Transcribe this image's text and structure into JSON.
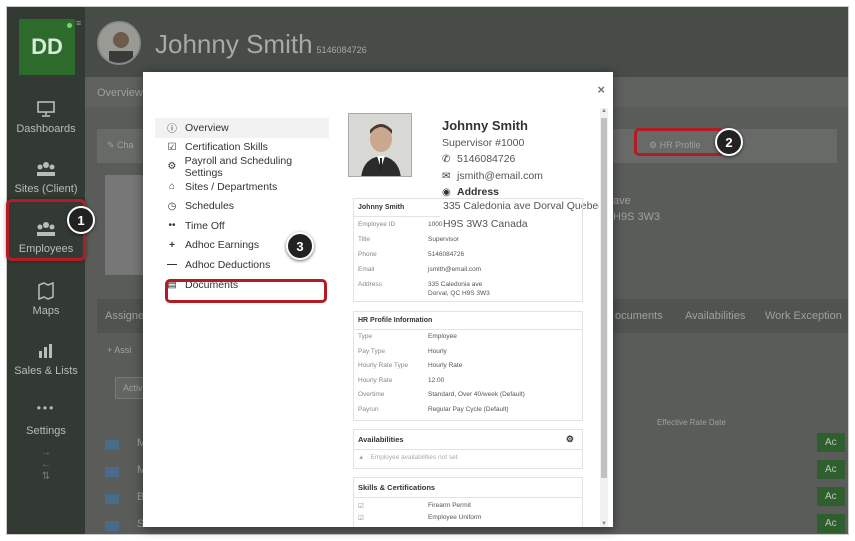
{
  "app": {
    "logo_initials": "DD"
  },
  "sidebar": {
    "items": [
      {
        "label": "Dashboards",
        "icon": "monitor-icon"
      },
      {
        "label": "Sites (Client)",
        "icon": "sites-icon"
      },
      {
        "label": "Employees",
        "icon": "employees-icon"
      },
      {
        "label": "Maps",
        "icon": "map-icon"
      },
      {
        "label": "Sales & Lists",
        "icon": "chart-icon"
      },
      {
        "label": "Settings",
        "icon": "dots-icon"
      }
    ]
  },
  "header": {
    "name": "Johnny Smith",
    "phone": "5146084726"
  },
  "page": {
    "tab_overview": "Overview",
    "change_label": "Cha",
    "hr_profile_tab": "HR Profile",
    "addr_fragment_1": "ave",
    "addr_fragment_2": "H9S 3W3",
    "assigned_label": "Assigne",
    "tabs_right": [
      "ocuments",
      "Availabilities",
      "Work Exception"
    ],
    "assign_button": "Assi",
    "active_filter": "Active",
    "effective_rate_header": "Effective Rate Date",
    "rows": [
      "Mo",
      "Mo",
      "Br",
      "Su"
    ],
    "row_badge": "Ac"
  },
  "modal": {
    "menu": [
      {
        "label": "Overview",
        "icon": "info-icon"
      },
      {
        "label": "Certification Skills",
        "icon": "checkbox-icon"
      },
      {
        "label": "Payroll and Scheduling Settings",
        "icon": "gear-icon"
      },
      {
        "label": "Sites / Departments",
        "icon": "home-icon"
      },
      {
        "label": "Schedules",
        "icon": "clock-icon"
      },
      {
        "label": "Time Off",
        "icon": "ellipsis-icon"
      },
      {
        "label": "Adhoc Earnings",
        "icon": "plus-icon"
      },
      {
        "label": "Adhoc Deductions",
        "icon": "minus-icon"
      },
      {
        "label": "Documents",
        "icon": "document-icon"
      }
    ],
    "profile": {
      "name": "Johnny Smith",
      "role": "Supervisor #1000",
      "phone": "5146084726",
      "email": "jsmith@email.com",
      "address_label": "Address",
      "address_line1": "335 Caledonia ave Dorval Quebec",
      "address_line2": "H9S 3W3 Canada"
    },
    "summary_card": {
      "title": "Johnny Smith",
      "rows": [
        {
          "k": "Employee ID",
          "v": "1000"
        },
        {
          "k": "Title",
          "v": "Supervisor"
        },
        {
          "k": "Phone",
          "v": "5146084726"
        },
        {
          "k": "Email",
          "v": "jsmith@email.com"
        },
        {
          "k": "Address",
          "v": "335 Caledonia ave"
        },
        {
          "k": "",
          "v": "Dorval, QC H9S 3W3"
        }
      ]
    },
    "hr_card": {
      "title": "HR Profile Information",
      "rows": [
        {
          "k": "Type",
          "v": "Employee"
        },
        {
          "k": "Pay Type",
          "v": "Hourly"
        },
        {
          "k": "Hourly Rate Type",
          "v": "Hourly Rate"
        },
        {
          "k": "Hourly Rate",
          "v": "12.00"
        },
        {
          "k": "Overtime",
          "v": "Standard, Over 40/week (Default)"
        },
        {
          "k": "Payrun",
          "v": "Regular Pay Cycle (Default)"
        }
      ]
    },
    "avail_card": {
      "title": "Availabilities",
      "empty": "Employee availabilities not set"
    },
    "skills_card": {
      "title": "Skills & Certifications",
      "items": [
        "Firearm Permit",
        "Employee Uniform"
      ]
    }
  },
  "callouts": [
    "1",
    "2",
    "3"
  ],
  "colors": {
    "accent_red": "#b31c24",
    "brand_green": "#2c6b2c",
    "sidebar_bg": "#333a33"
  }
}
